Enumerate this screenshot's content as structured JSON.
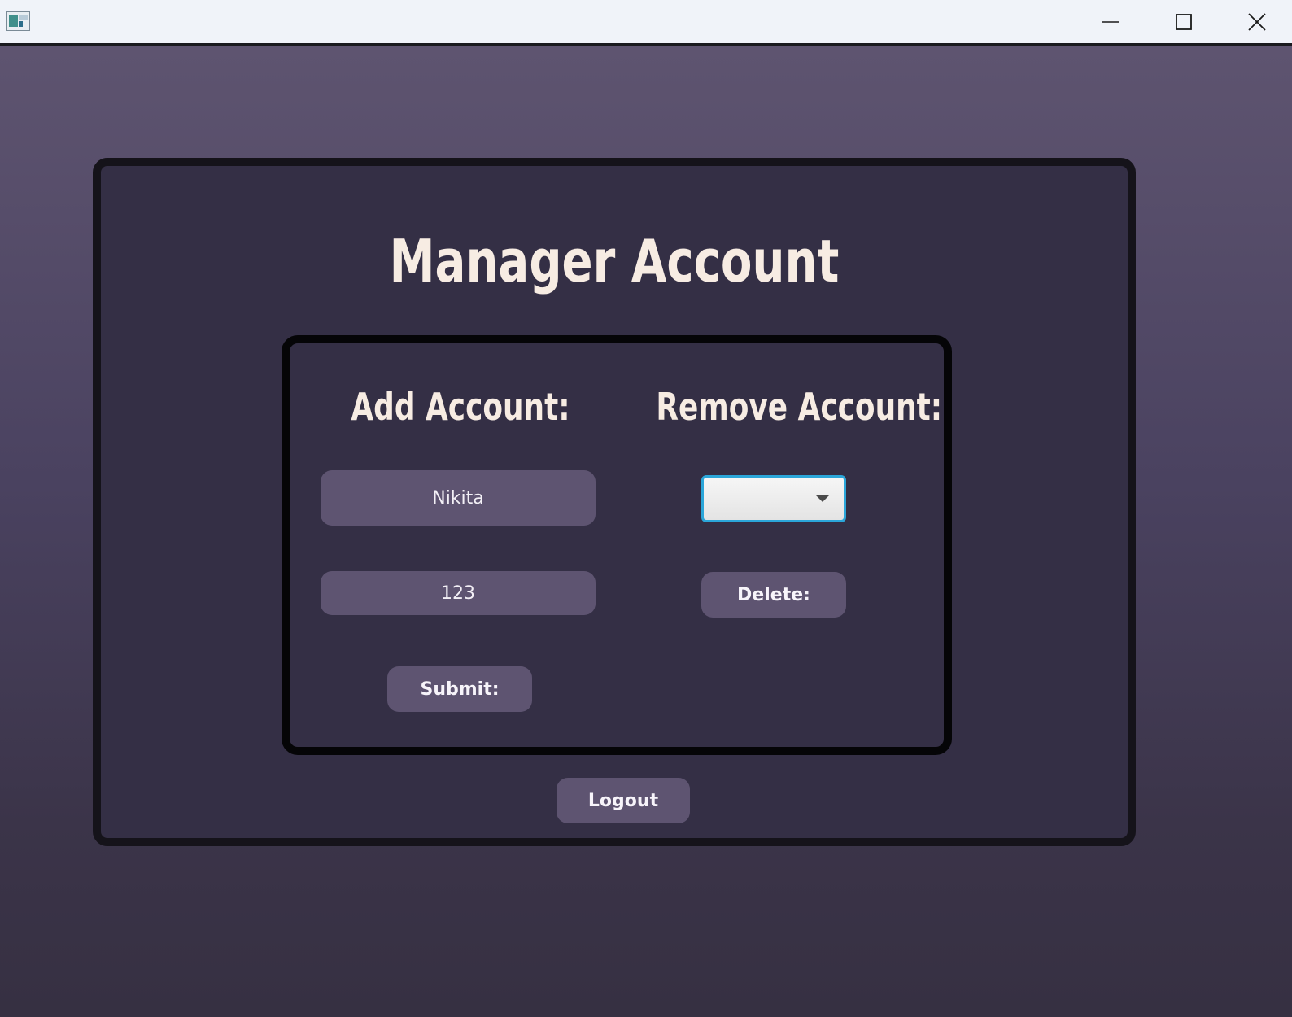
{
  "window": {
    "title": "",
    "controls": {
      "minimize_icon": "minimize-icon",
      "maximize_icon": "maximize-icon",
      "close_icon": "close-icon"
    }
  },
  "page": {
    "title": "Manager Account"
  },
  "add_account": {
    "heading": "Add Account:",
    "username_value": "Nikita",
    "password_value": "123",
    "submit_label": "Submit:"
  },
  "remove_account": {
    "heading": "Remove Account:",
    "selected_account": "",
    "delete_label": "Delete:"
  },
  "logout_label": "Logout",
  "colors": {
    "background_top": "#5e5470",
    "background_bottom": "#363042",
    "panel": "#342f45",
    "control": "#5e5471",
    "title_text": "#f7ece3",
    "combo_focus": "#2ba6d9"
  }
}
